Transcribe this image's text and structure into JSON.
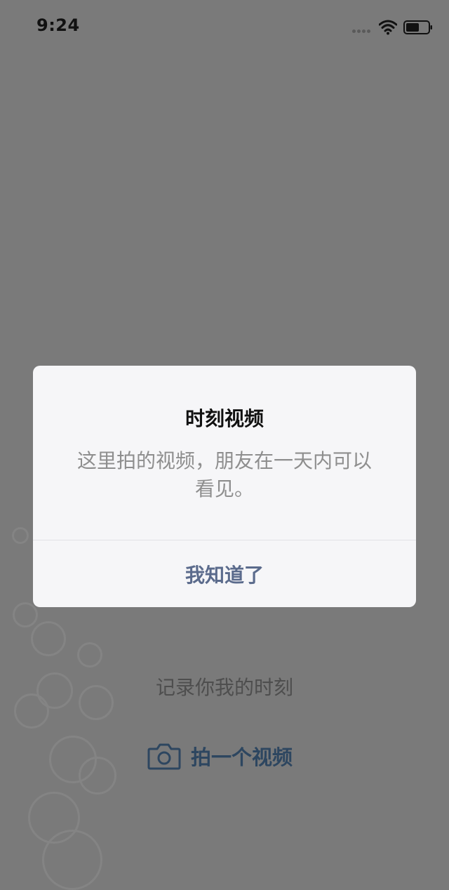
{
  "status_bar": {
    "time": "9:24"
  },
  "background": {
    "caption": "记录你我的时刻",
    "shoot_button_label": "拍一个视频",
    "accent_color": "#2d4660"
  },
  "dialog": {
    "title": "时刻视频",
    "message": "这里拍的视频，朋友在一天内可以看见。",
    "confirm_label": "我知道了",
    "confirm_color": "#5b6b8c"
  },
  "icons": [
    "cellular-signal-icon",
    "wifi-icon",
    "battery-icon",
    "camera-icon"
  ]
}
